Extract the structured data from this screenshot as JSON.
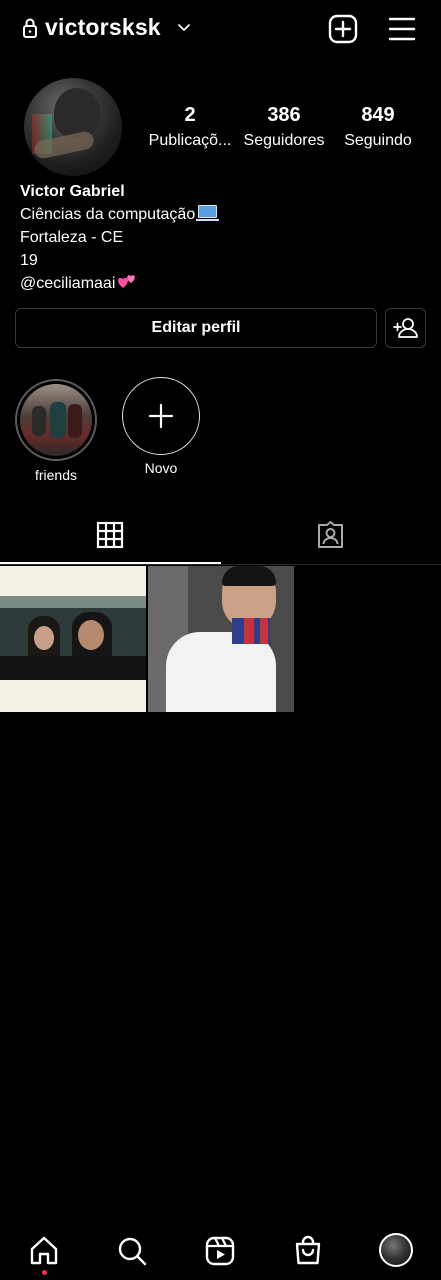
{
  "header": {
    "username": "victorsksk"
  },
  "profile": {
    "stats": [
      {
        "value": "2",
        "label": "Publicaçõ..."
      },
      {
        "value": "386",
        "label": "Seguidores"
      },
      {
        "value": "849",
        "label": "Seguindo"
      }
    ],
    "name": "Victor Gabriel",
    "bio_line1": "Ciências da computação",
    "bio_line2": "Fortaleza - CE",
    "bio_line3": "19",
    "bio_line4": "@ceciliamaai",
    "edit_button": "Editar perfil"
  },
  "highlights": [
    {
      "label": "friends"
    },
    {
      "label": "Novo"
    }
  ],
  "icons": {
    "lock": "lock-icon",
    "add_post": "plus-square-icon",
    "menu": "hamburger-menu-icon",
    "grid_tab": "grid-icon",
    "tagged_tab": "tagged-person-icon",
    "add_user": "add-user-icon",
    "nav": [
      "home-icon",
      "search-icon",
      "reels-icon",
      "shop-icon",
      "profile-avatar"
    ]
  },
  "colors": {
    "background": "#000000",
    "text": "#ffffff",
    "notification_dot": "#ff3040"
  }
}
